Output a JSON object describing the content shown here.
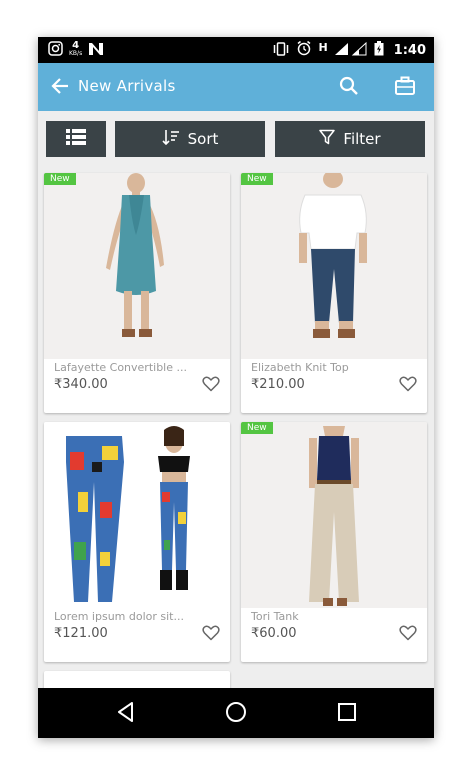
{
  "status_bar": {
    "net_speed": "4",
    "net_unit": "KB/s",
    "network_type": "H",
    "time": "1:40",
    "icons": [
      "instagram-icon",
      "n-app-icon",
      "vibrate-icon",
      "alarm-icon",
      "signal-icon",
      "battery-charging-icon"
    ]
  },
  "app_bar": {
    "title": "New Arrivals",
    "back_icon": "arrow-back-icon",
    "search_icon": "search-icon",
    "bag_icon": "briefcase-icon",
    "color": "#5fb0d9"
  },
  "toolbar": {
    "list_icon": "list-view-icon",
    "sort_label": "Sort",
    "filter_label": "Filter",
    "button_color": "#3a4347"
  },
  "products": [
    {
      "badge": "New",
      "name": "Lafayette Convertible ...",
      "price": "₹340.00",
      "image": "woman-in-teal-dress"
    },
    {
      "badge": "New",
      "name": "Elizabeth Knit Top",
      "price": "₹210.00",
      "image": "woman-in-white-top-and-jeans"
    },
    {
      "badge": "",
      "name": "Lorem ipsum dolor sit...",
      "price": "₹121.00",
      "image": "comic-print-leggings"
    },
    {
      "badge": "New",
      "name": "Tori Tank",
      "price": "₹60.00",
      "image": "woman-in-navy-tank-and-beige-pants"
    }
  ],
  "badge_color": "#54c542",
  "nav_bar": {
    "back_icon": "nav-back-icon",
    "home_icon": "nav-home-icon",
    "recents_icon": "nav-recents-icon"
  }
}
